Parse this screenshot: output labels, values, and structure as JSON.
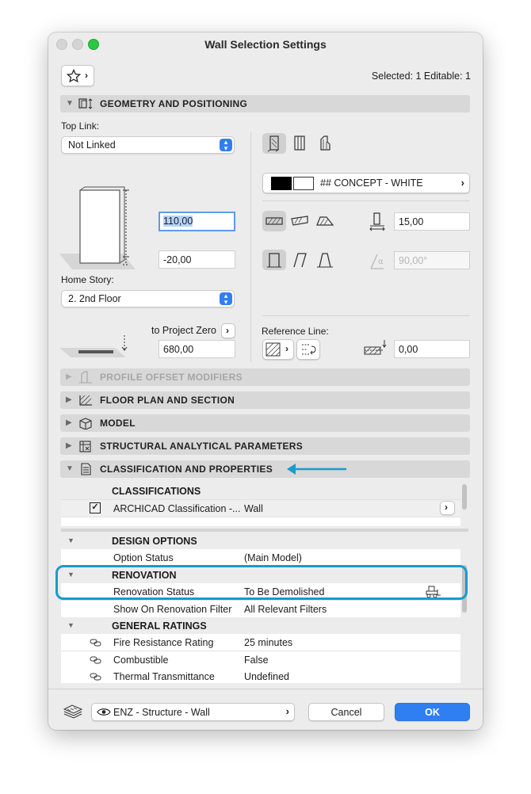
{
  "window": {
    "title": "Wall Selection Settings"
  },
  "header": {
    "selection_info": "Selected: 1 Editable: 1"
  },
  "sections": {
    "geometry": "GEOMETRY AND POSITIONING",
    "profile_offset": "PROFILE OFFSET MODIFIERS",
    "floor_plan": "FLOOR PLAN AND SECTION",
    "model": "MODEL",
    "structural": "STRUCTURAL ANALYTICAL PARAMETERS",
    "classification": "CLASSIFICATION AND PROPERTIES"
  },
  "geometry": {
    "top_link_label": "Top Link:",
    "top_link_value": "Not Linked",
    "height_value": "110,00",
    "base_offset_value": "-20,00",
    "home_story_label": "Home Story:",
    "home_story_value": "2. 2nd Floor",
    "to_project_zero_label": "to Project Zero",
    "project_zero_value": "680,00",
    "composite_name": "## CONCEPT - WHITE",
    "thickness_value": "15,00",
    "angle_value": "90,00°",
    "reference_line_label": "Reference Line:",
    "ref_offset_value": "0,00"
  },
  "classification_table": {
    "classifications_header": "CLASSIFICATIONS",
    "class_row": {
      "name": "ARCHICAD Classification -...",
      "value": "Wall"
    }
  },
  "properties": [
    {
      "group": "DESIGN OPTIONS",
      "rows": [
        {
          "name": "Option Status",
          "value": "(Main Model)"
        }
      ]
    },
    {
      "group": "RENOVATION",
      "rows": [
        {
          "name": "Renovation Status",
          "value": "To Be Demolished"
        },
        {
          "name": "Show On Renovation Filter",
          "value": "All Relevant Filters"
        }
      ]
    },
    {
      "group": "GENERAL RATINGS",
      "rows": [
        {
          "name": "Fire Resistance Rating",
          "value": "25 minutes"
        },
        {
          "name": "Combustible",
          "value": "False"
        },
        {
          "name": "Thermal Transmittance",
          "value": "Undefined"
        }
      ]
    }
  ],
  "footer": {
    "layer_value": "ENZ - Structure - Wall",
    "cancel_label": "Cancel",
    "ok_label": "OK"
  },
  "colors": {
    "accent": "#2f7ff3",
    "annotation": "#1a9ad0",
    "traffic_close": "#ff5f57",
    "traffic_min": "#febc2e",
    "traffic_max": "#28c840"
  }
}
